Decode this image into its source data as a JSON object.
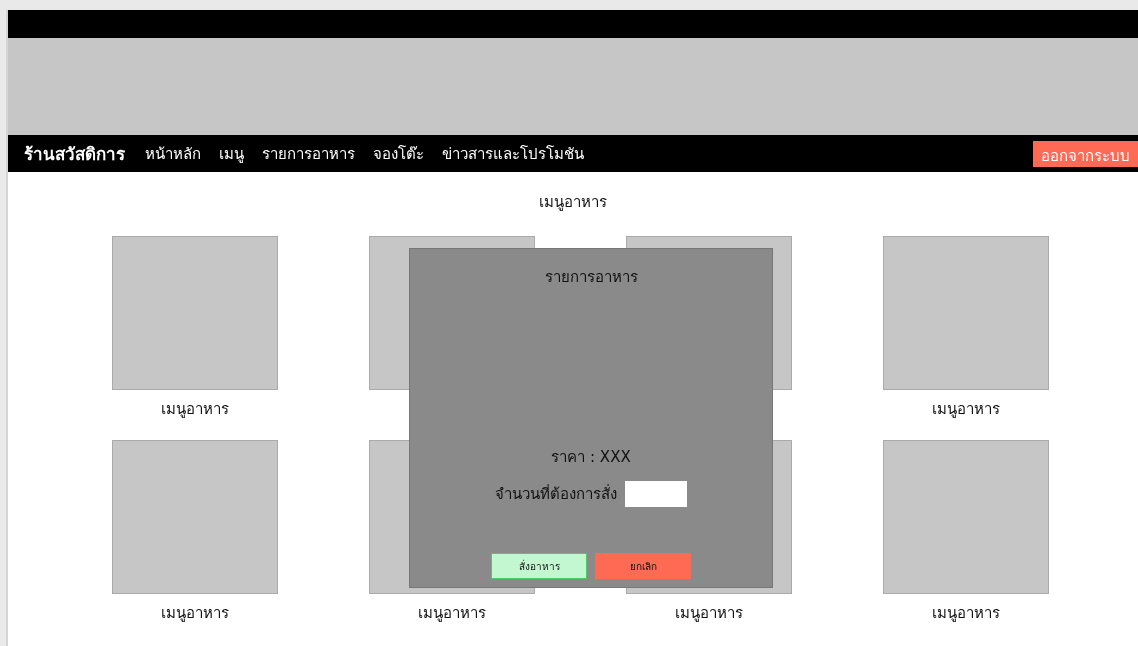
{
  "nav": {
    "brand": "ร้านสวัสดิการ",
    "links": [
      "หน้าหลัก",
      "เมนู",
      "รายการอาหาร",
      "จองโต๊ะ",
      "ข่าวสารและโปรโมชัน"
    ],
    "logout": "ออกจากระบบ"
  },
  "section_title": "เมนูอาหาร",
  "menu_items": [
    {
      "kind": "card",
      "label": "เมนูอาหาร"
    },
    {
      "kind": "card"
    },
    {
      "kind": "card"
    },
    {
      "kind": "card",
      "label": "เมนูอาหาร"
    },
    {
      "kind": "card",
      "label": "เมนูอาหาร"
    },
    {
      "kind": "card",
      "label": "เมนูอาหาร"
    },
    {
      "kind": "card",
      "label": "เมนูอาหาร"
    },
    {
      "kind": "card",
      "label": "เมนูอาหาร"
    }
  ],
  "dialog": {
    "title": "รายการอาหาร",
    "price": "ราคา : XXX",
    "quantity_label": "จำนวนที่ต้องการสั่ง",
    "buttons": [
      {
        "label": "สั่งอาหาร",
        "kind": "confirm"
      },
      {
        "label": "ยกเลิก",
        "kind": "cancel"
      }
    ]
  }
}
